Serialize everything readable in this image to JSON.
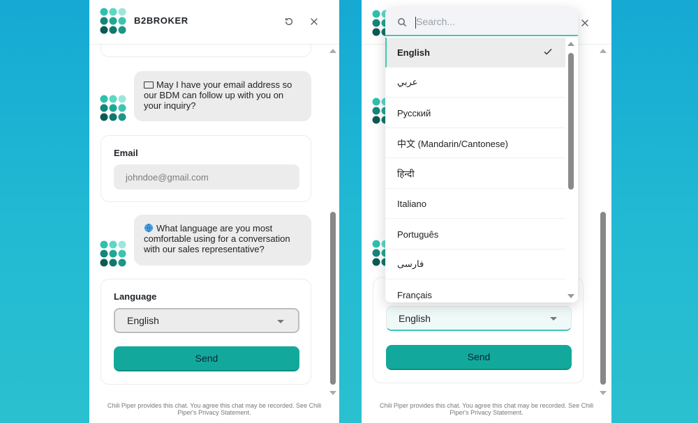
{
  "brand": {
    "name": "B2BROKER"
  },
  "colors": {
    "accent": "#12a99c",
    "background": "#20b2d0",
    "focus": "#3fc7b4"
  },
  "messages": {
    "email_prompt": "May I have your email address so our BDM can follow up with you on your inquiry?",
    "language_prompt": "What language are you most comfortable using for a conversation with our sales representative?"
  },
  "email_form": {
    "label": "Email",
    "value": "johndoe@gmail.com"
  },
  "language_form": {
    "label": "Language",
    "selected": "English",
    "send_label": "Send"
  },
  "footer": {
    "text": "Chili Piper provides this chat. You agree this chat may be recorded. See Chili Piper's Privacy Statement."
  },
  "dropdown": {
    "search_placeholder": "Search...",
    "options": [
      {
        "label": "English",
        "selected": true
      },
      {
        "label": "عربي"
      },
      {
        "label": "Русский"
      },
      {
        "label": "中文 (Mandarin/Cantonese)"
      },
      {
        "label": "हिन्दी"
      },
      {
        "label": "Italiano"
      },
      {
        "label": "Português"
      },
      {
        "label": "فارسی"
      },
      {
        "label": "Français"
      }
    ]
  },
  "icons": {
    "logo": "b2broker-logo",
    "reset": "refresh-icon",
    "close": "close-icon",
    "email": "envelope-icon",
    "globe": "globe-icon",
    "search": "search-icon",
    "check": "check-icon"
  }
}
